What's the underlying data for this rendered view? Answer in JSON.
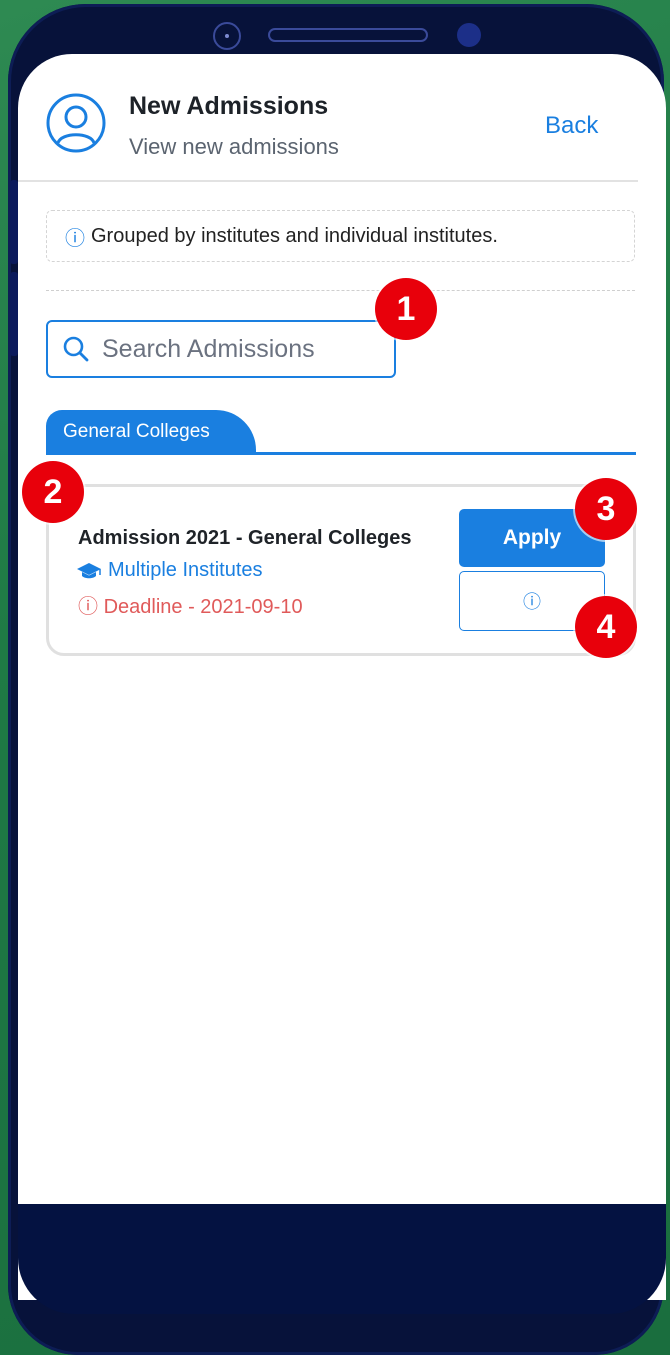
{
  "header": {
    "title": "New Admissions",
    "subtitle": "View new admissions",
    "back_label": "Back"
  },
  "note": {
    "icon": "info-icon",
    "text": "Grouped by institutes and individual institutes."
  },
  "search": {
    "placeholder": "Search Admissions",
    "value": ""
  },
  "tabs": [
    {
      "label": "General Colleges",
      "active": true
    }
  ],
  "admissions": [
    {
      "title": "Admission 2021 - General Colleges",
      "institutes": "Multiple Institutes",
      "deadline": "Deadline - 2021-09-10",
      "apply_label": "Apply",
      "info_icon": "info-icon"
    }
  ],
  "annotations": [
    "1",
    "2",
    "3",
    "4"
  ],
  "colors": {
    "accent": "#1a7fe0",
    "deadline": "#e05a5a",
    "badge": "#e8000b",
    "frame": "#07123a"
  }
}
